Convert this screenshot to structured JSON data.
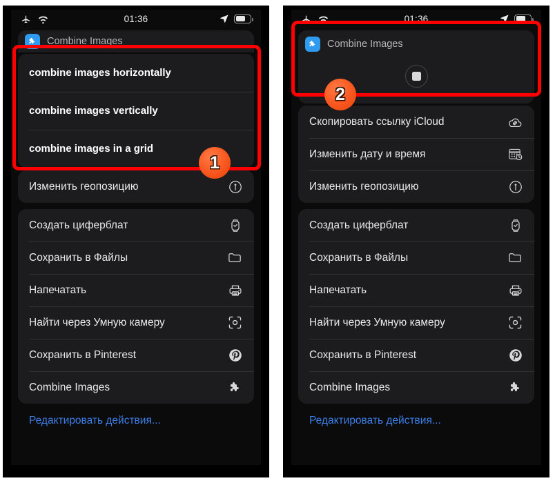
{
  "meta": {
    "accent_red": "#fe0000",
    "accent_orange": "#fa5b22",
    "app_icon_blue": "#2f9bf0",
    "link_blue": "#3c7fe8",
    "sheet_bg": "#1c1c1e",
    "screen_bg": "#0b0b0b"
  },
  "status_bar": {
    "time": "01:36",
    "left_icons": [
      "airplane-mode-icon",
      "wifi-icon"
    ],
    "right_icons": [
      "location-arrow-icon",
      "battery-icon"
    ]
  },
  "left_panel": {
    "header": {
      "app_name": "Combine Images",
      "icon": "combine-images-app-icon"
    },
    "menu_options": [
      {
        "label": "combine images horizontally"
      },
      {
        "label": "combine images vertically"
      },
      {
        "label": "combine images in a grid"
      }
    ],
    "group_one": [
      {
        "label": "Изменить геопозицию",
        "icon": "location-pin-circle-icon"
      }
    ],
    "group_two": [
      {
        "label": "Создать циферблат",
        "icon": "watch-face-icon"
      },
      {
        "label": "Сохранить в Файлы",
        "icon": "folder-icon"
      },
      {
        "label": "Напечатать",
        "icon": "printer-icon"
      },
      {
        "label": "Найти через Умную камеру",
        "icon": "visual-lookup-icon"
      },
      {
        "label": "Сохранить в Pinterest",
        "icon": "pinterest-icon"
      },
      {
        "label": "Combine Images",
        "icon": "puzzle-piece-icon"
      }
    ],
    "edit_actions_label": "Редактировать действия..."
  },
  "right_panel": {
    "header": {
      "app_name": "Combine Images",
      "icon": "combine-images-app-icon",
      "stop_button": "stop-button"
    },
    "group_one": [
      {
        "label": "Скопировать ссылку iCloud",
        "icon": "icloud-link-icon"
      },
      {
        "label": "Изменить дату и время",
        "icon": "calendar-clock-icon"
      },
      {
        "label": "Изменить геопозицию",
        "icon": "location-pin-circle-icon"
      }
    ],
    "group_two": [
      {
        "label": "Создать циферблат",
        "icon": "watch-face-icon"
      },
      {
        "label": "Сохранить в Файлы",
        "icon": "folder-icon"
      },
      {
        "label": "Напечатать",
        "icon": "printer-icon"
      },
      {
        "label": "Найти через Умную камеру",
        "icon": "visual-lookup-icon"
      },
      {
        "label": "Сохранить в Pinterest",
        "icon": "pinterest-icon"
      },
      {
        "label": "Combine Images",
        "icon": "puzzle-piece-icon"
      }
    ],
    "edit_actions_label": "Редактировать действия..."
  },
  "annotations": {
    "badge_one": "1",
    "badge_two": "2"
  }
}
